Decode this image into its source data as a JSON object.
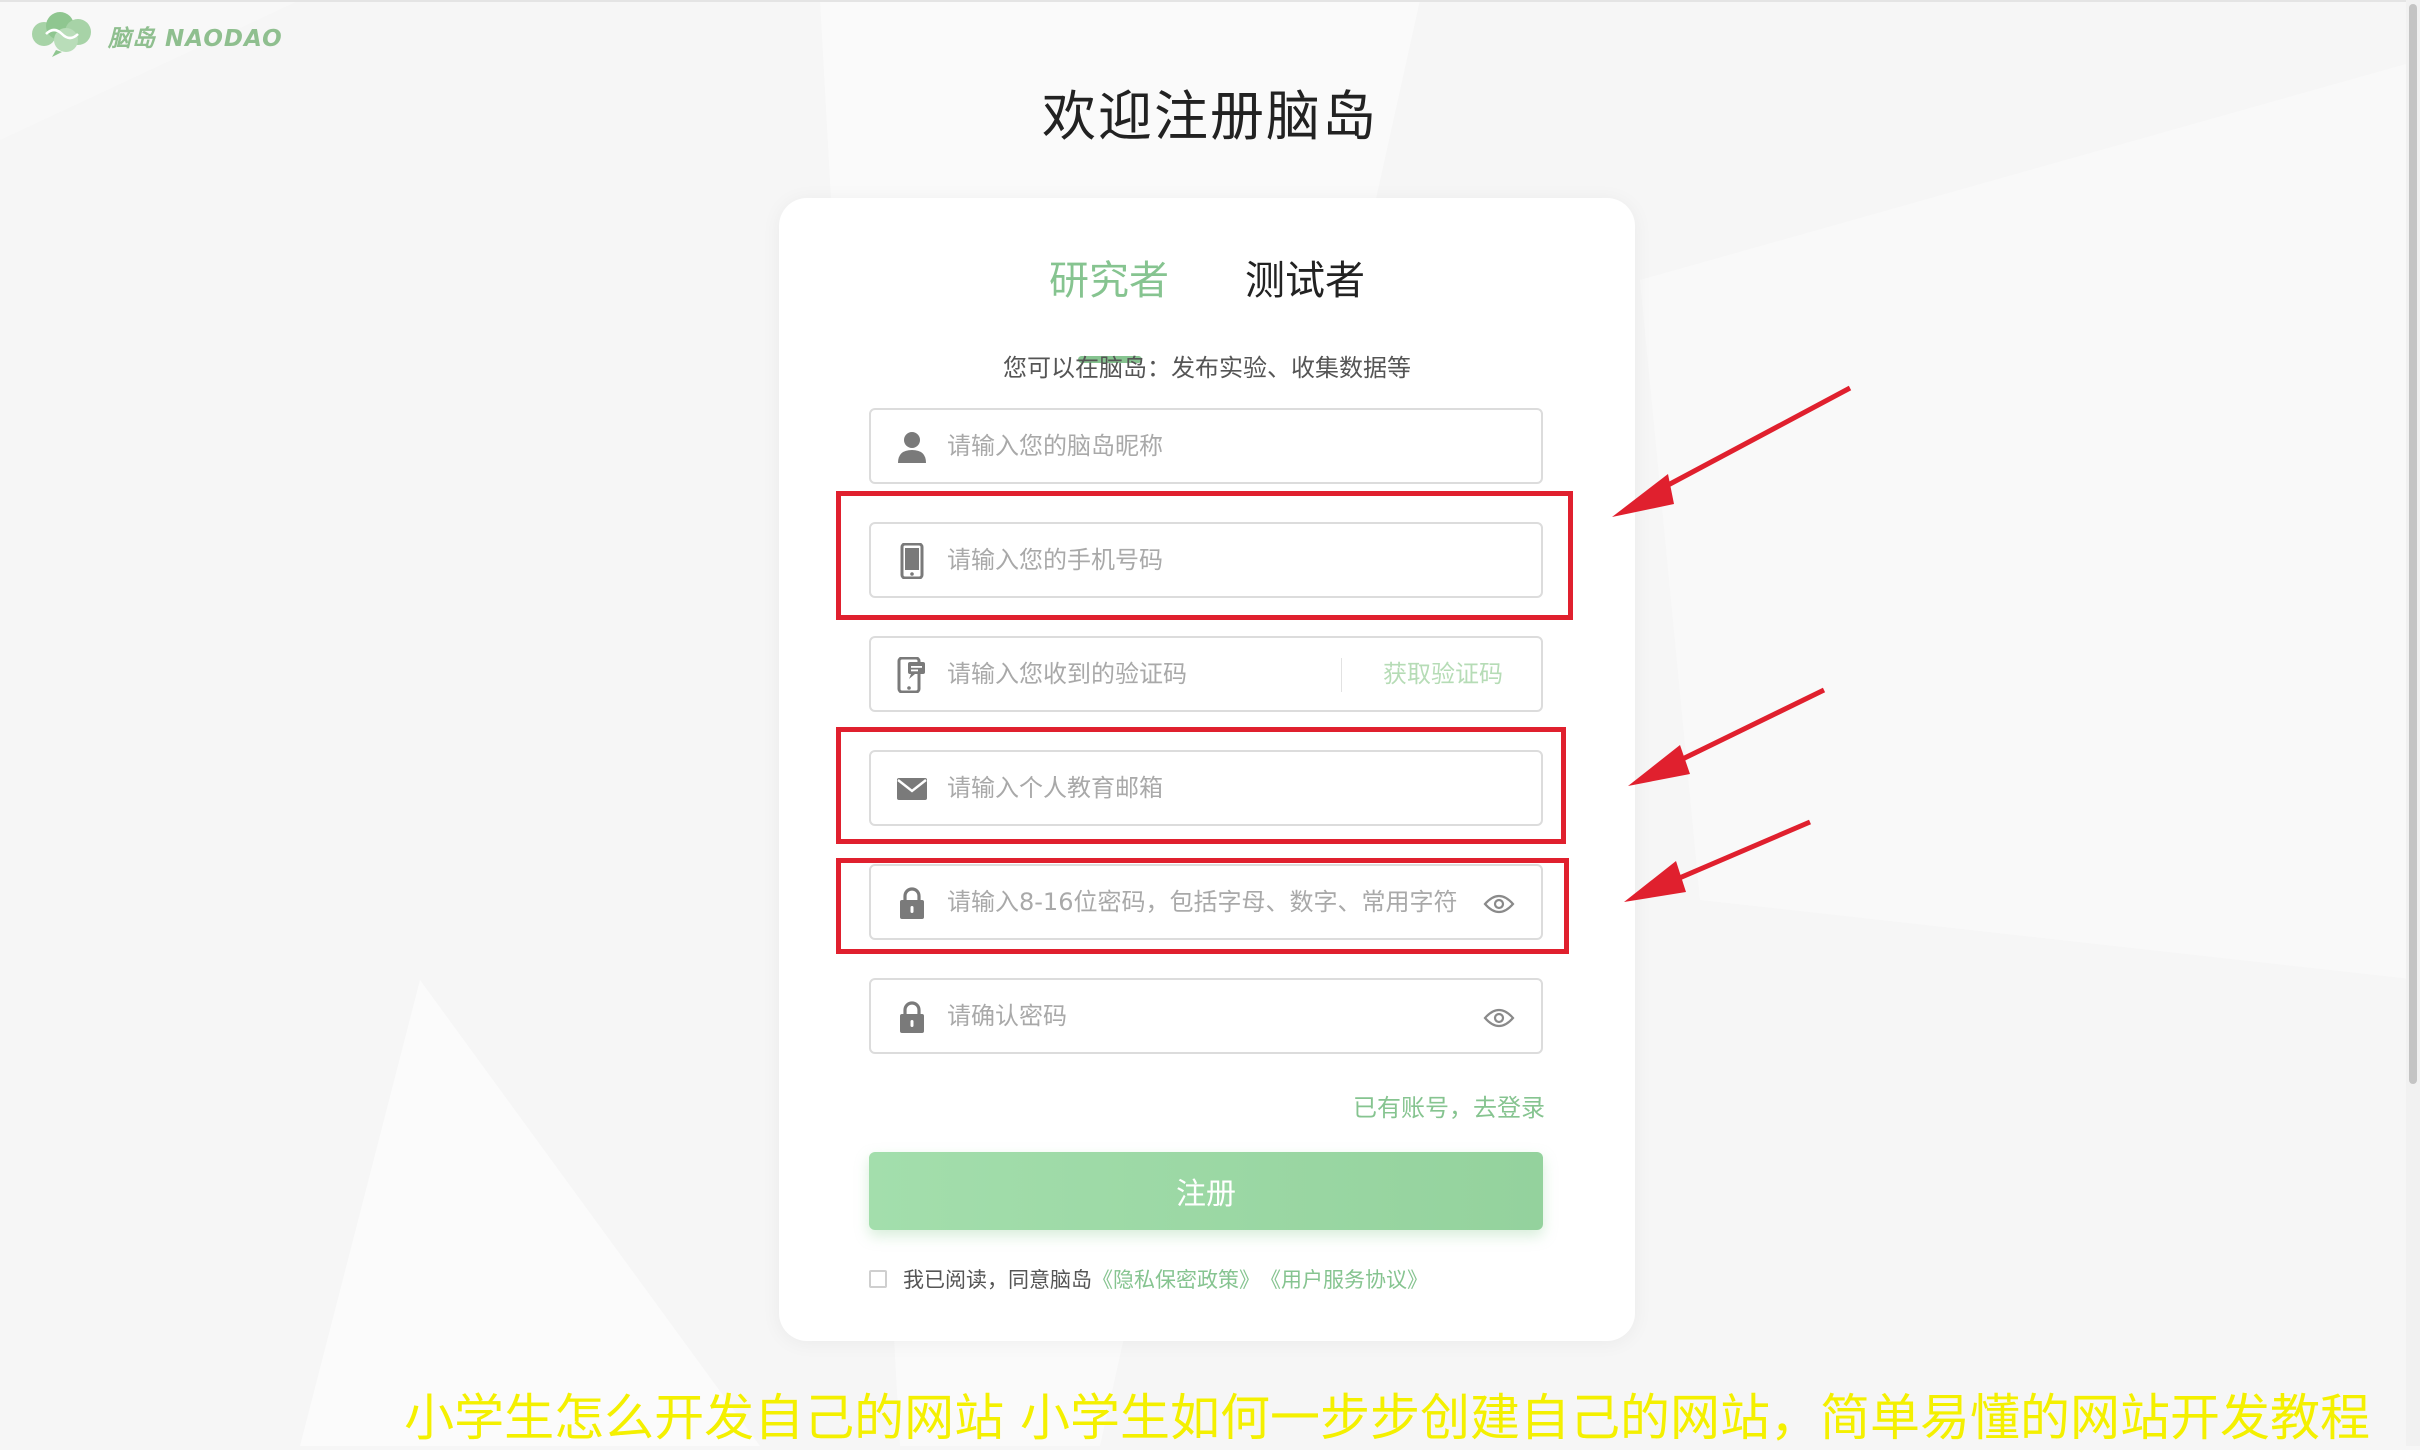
{
  "logo": {
    "text": "脑岛 NAODAO"
  },
  "page_title": "欢迎注册脑岛",
  "tabs": [
    {
      "label": "研究者",
      "active": true
    },
    {
      "label": "测试者",
      "active": false
    }
  ],
  "subtitle": "您可以在脑岛：发布实验、收集数据等",
  "form": {
    "nickname": {
      "placeholder": "请输入您的脑岛昵称",
      "value": "",
      "icon": "user-icon"
    },
    "phone": {
      "placeholder": "请输入您的手机号码",
      "value": "",
      "icon": "phone-icon"
    },
    "code": {
      "placeholder": "请输入您收到的验证码",
      "value": "",
      "icon": "sms-phone-icon",
      "button": "获取验证码"
    },
    "email": {
      "placeholder": "请输入个人教育邮箱",
      "value": "",
      "icon": "mail-icon"
    },
    "password": {
      "placeholder": "请输入8-16位密码，包括字母、数字、常用字符",
      "value": "",
      "icon": "lock-icon"
    },
    "confirm": {
      "placeholder": "请确认密码",
      "value": "",
      "icon": "lock-icon"
    }
  },
  "login_link": "已有账号，去登录",
  "submit_label": "注册",
  "agreement": {
    "text": "我已阅读，同意脑岛",
    "privacy": "《隐私保密政策》",
    "service": "《用户服务协议》"
  },
  "caption": "小学生怎么开发自己的网站 小学生如何一步步创建自己的网站，简单易懂的网站开发教程",
  "colors": {
    "accent": "#86c490",
    "annotation": "#e0202e",
    "caption": "#f4f000"
  }
}
